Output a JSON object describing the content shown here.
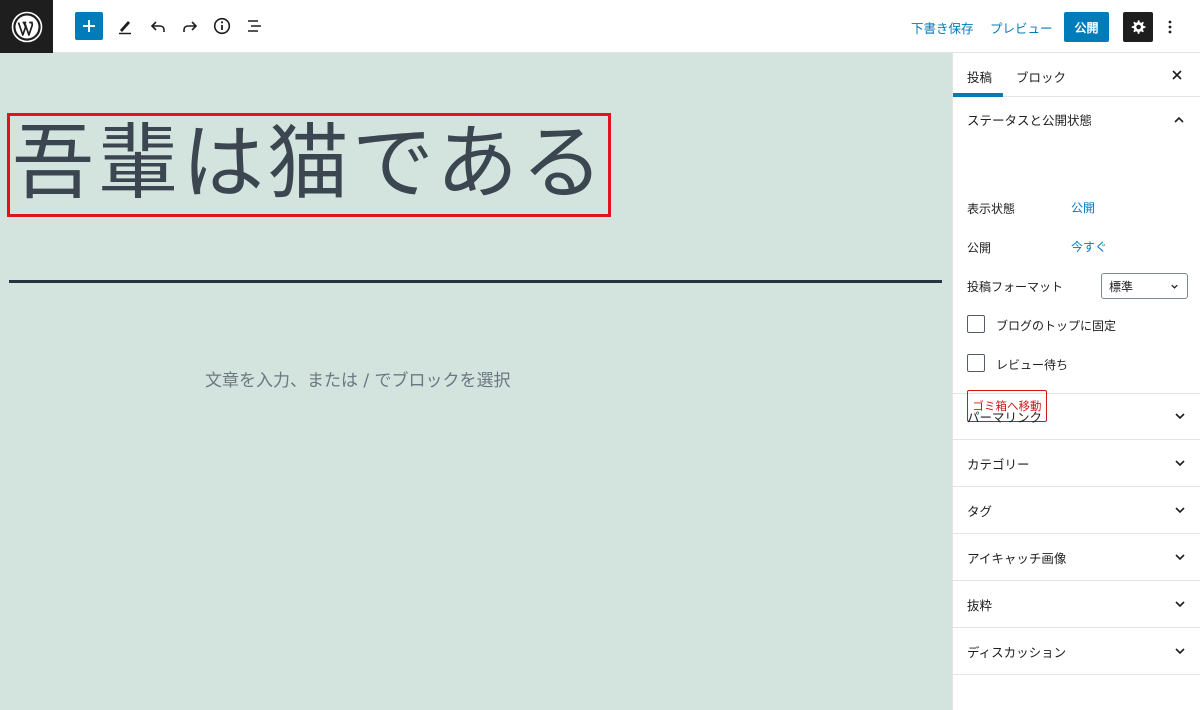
{
  "toolbar": {
    "save_draft": "下書き保存",
    "preview": "プレビュー",
    "publish": "公開"
  },
  "editor": {
    "title": "吾輩は猫である",
    "placeholder": "文章を入力、または / でブロックを選択"
  },
  "sidebar": {
    "tabs": [
      {
        "label": "投稿",
        "active": true
      },
      {
        "label": "ブロック",
        "active": false
      }
    ],
    "status_panel": {
      "title": "ステータスと公開状態",
      "visibility_label": "表示状態",
      "visibility_value": "公開",
      "publish_label": "公開",
      "publish_value": "今すぐ",
      "format_label": "投稿フォーマット",
      "format_value": "標準",
      "sticky_label": "ブログのトップに固定",
      "sticky_checked": false,
      "pending_label": "レビュー待ち",
      "pending_checked": false,
      "trash_label": "ゴミ箱へ移動"
    },
    "panels": [
      {
        "title": "パーマリンク"
      },
      {
        "title": "カテゴリー"
      },
      {
        "title": "タグ"
      },
      {
        "title": "アイキャッチ画像"
      },
      {
        "title": "抜粋"
      },
      {
        "title": "ディスカッション"
      }
    ]
  },
  "colors": {
    "accent": "#007cba",
    "canvas": "#d3e4de",
    "highlight": "#e0141b",
    "danger": "#cc1818"
  }
}
